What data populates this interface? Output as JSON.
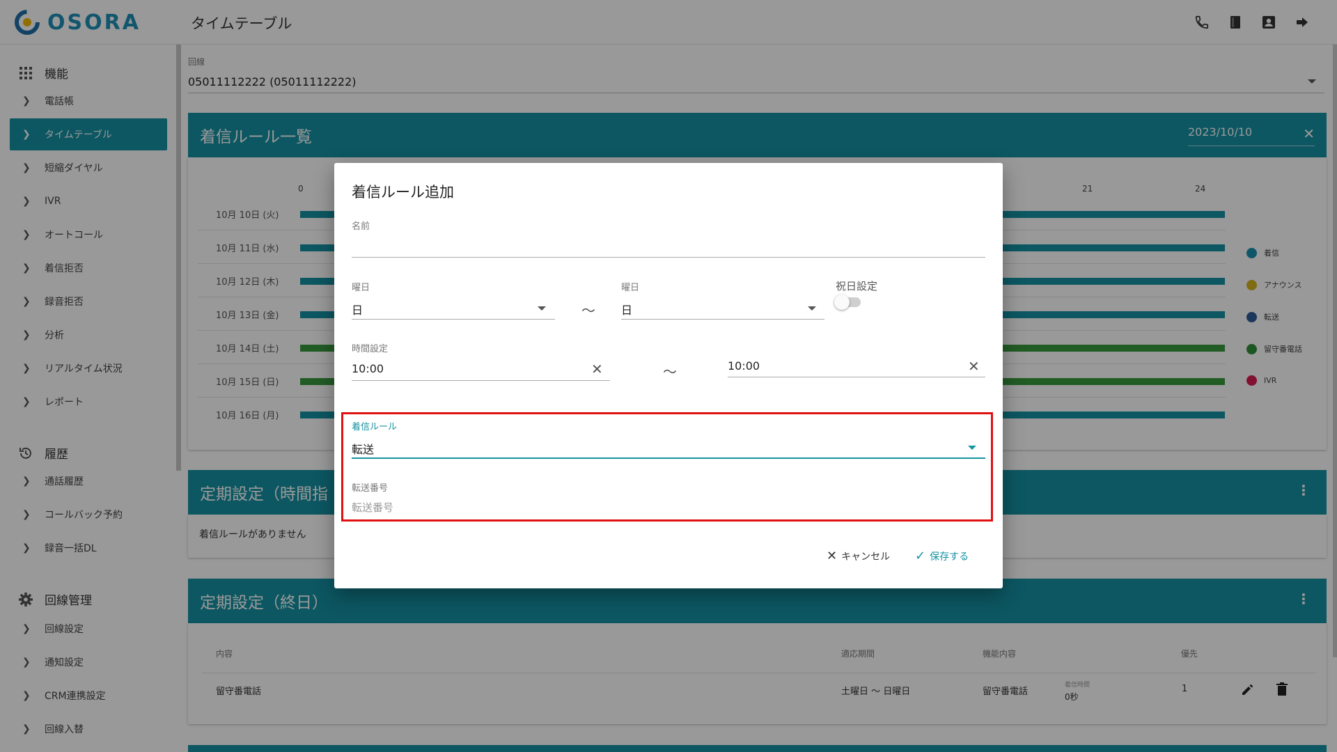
{
  "app": {
    "brand": "OSORA",
    "page_title": "タイムテーブル"
  },
  "topbar": {
    "icons": [
      "phone-icon",
      "book-icon",
      "contact-icon",
      "logout-icon"
    ]
  },
  "sidebar": {
    "sections": [
      {
        "title": "機能",
        "icon": "grid-icon",
        "items": [
          "電話帳",
          "タイムテーブル",
          "短縮ダイヤル",
          "IVR",
          "オートコール",
          "着信拒否",
          "録音拒否",
          "分析",
          "リアルタイム状況",
          "レポート"
        ]
      },
      {
        "title": "履歴",
        "icon": "history-icon",
        "items": [
          "通話履歴",
          "コールバック予約",
          "録音一括DL"
        ]
      },
      {
        "title": "回線管理",
        "icon": "gear-icon",
        "items": [
          "回線設定",
          "通知設定",
          "CRM連携設定",
          "回線入替"
        ]
      }
    ],
    "active_item": "タイムテーブル"
  },
  "line_select": {
    "label": "回線",
    "value": "05011112222 (05011112222)"
  },
  "incoming_rules_panel": {
    "title": "着信ルール一覧",
    "date": "2023/10/10",
    "axis_ticks": [
      "0",
      "21",
      "24"
    ],
    "rows": [
      {
        "label": "10月 10日 (火)",
        "color": "#1592a3"
      },
      {
        "label": "10月 11日 (水)",
        "color": "#1592a3"
      },
      {
        "label": "10月 12日 (木)",
        "color": "#1592a3"
      },
      {
        "label": "10月 13日 (金)",
        "color": "#1592a3"
      },
      {
        "label": "10月 14日 (土)",
        "color": "#3a9a3f"
      },
      {
        "label": "10月 15日 (日)",
        "color": "#3a9a3f"
      },
      {
        "label": "10月 16日 (月)",
        "color": "#1592a3"
      }
    ],
    "legend": [
      {
        "label": "着信",
        "color": "#1b8fb0"
      },
      {
        "label": "アナウンス",
        "color": "#d4b21f"
      },
      {
        "label": "転送",
        "color": "#2e5d9a"
      },
      {
        "label": "留守番電話",
        "color": "#2f8f3a"
      },
      {
        "label": "IVR",
        "color": "#d81b53"
      }
    ]
  },
  "periodic_time_panel": {
    "title": "定期設定（時間指",
    "empty_text": "着信ルールがありません"
  },
  "periodic_allday_panel": {
    "title": "定期設定（終日）",
    "columns": [
      "内容",
      "適応期間",
      "機能内容",
      "優先"
    ],
    "row": {
      "content": "留守番電話",
      "period": "土曜日 ～ 日曜日",
      "function": "留守番電話",
      "sub_label": "着信時間",
      "sub_value": "0秒",
      "priority": "1"
    }
  },
  "dialog": {
    "title": "着信ルール追加",
    "name": {
      "label": "名前",
      "value": ""
    },
    "day_from": {
      "label": "曜日",
      "value": "日"
    },
    "day_to": {
      "label": "曜日",
      "value": "日"
    },
    "range_sep": "～",
    "holiday": {
      "label": "祝日設定",
      "on": false
    },
    "time": {
      "label": "時間設定",
      "from": "10:00",
      "to": "10:00"
    },
    "rule": {
      "label": "着信ルール",
      "value": "転送"
    },
    "forward": {
      "label": "転送番号",
      "placeholder": "転送番号"
    },
    "cancel_label": "キャンセル",
    "save_label": "保存する"
  }
}
